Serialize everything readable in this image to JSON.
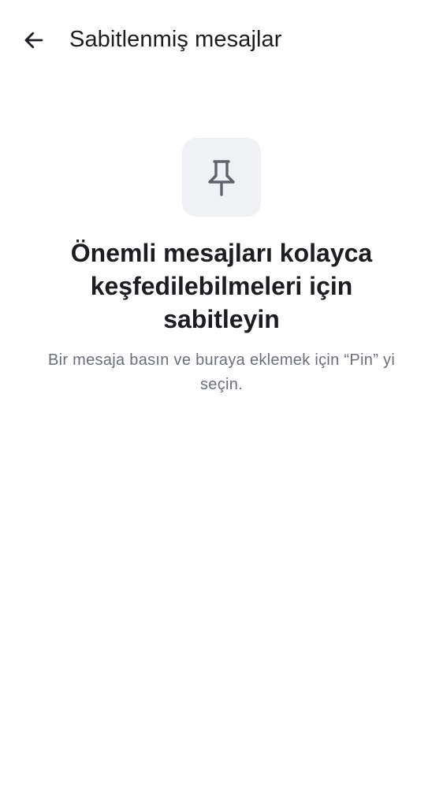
{
  "header": {
    "title": "Sabitlenmiş mesajlar",
    "back_icon": "arrow-left-icon"
  },
  "empty_state": {
    "icon": "pin-icon",
    "title": "Önemli mesajları kolayca keşfedilebilmeleri için sabitleyin",
    "description": "Bir mesaja basın ve buraya eklemek için “Pin” yi seçin."
  },
  "colors": {
    "background": "#ffffff",
    "text_primary": "#1b1d21",
    "text_secondary": "#6b6f78",
    "icon_box": "#f0f1f4",
    "icon": "#5f636b"
  }
}
